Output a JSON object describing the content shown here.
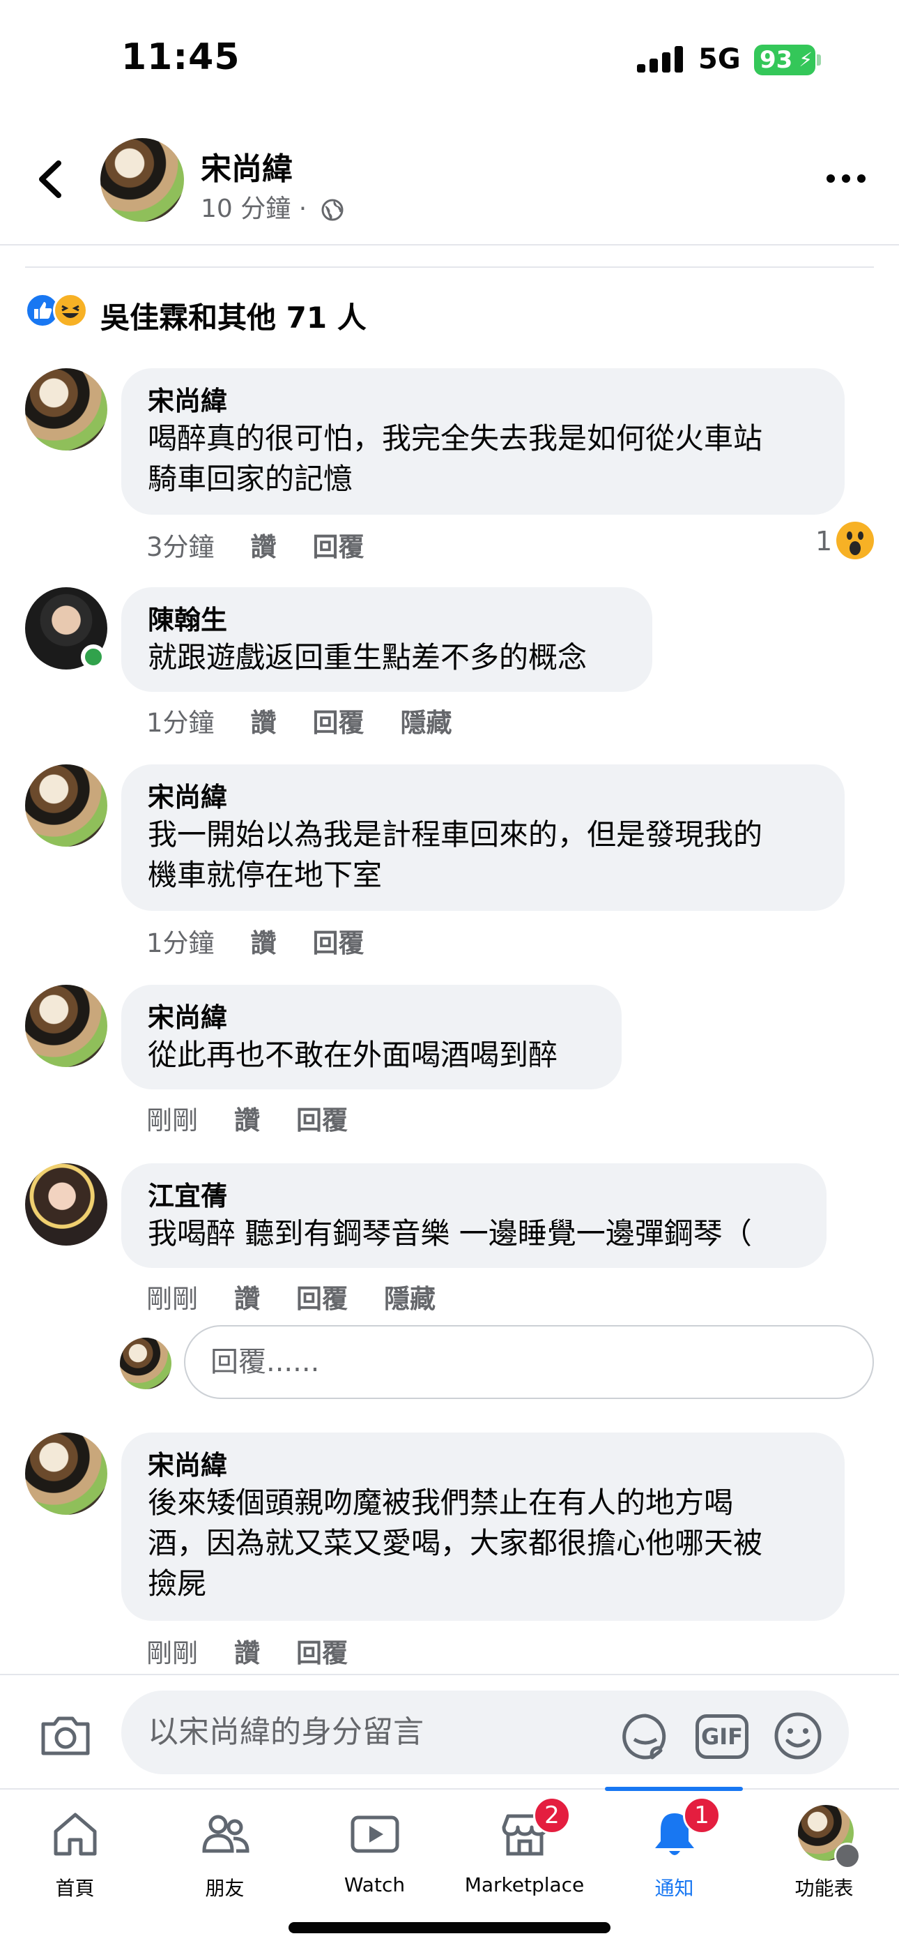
{
  "status_bar": {
    "time": "11:45",
    "network": "5G",
    "battery": "93"
  },
  "header": {
    "author": "宋尚緯",
    "meta": "10 分鐘 ·"
  },
  "reactions": {
    "summary": "吳佳霖和其他 71 人"
  },
  "comments": [
    {
      "name": "宋尚緯",
      "text": "喝醉真的很可怕，我完全失去我是如何從火車站\n騎車回家的記憶",
      "time": "3分鐘",
      "like": "讚",
      "reply": "回覆",
      "reaction_count": "1"
    },
    {
      "name": "陳翰生",
      "text": "就跟遊戲返回重生點差不多的概念",
      "time": "1分鐘",
      "like": "讚",
      "reply": "回覆",
      "hide": "隱藏"
    },
    {
      "name": "宋尚緯",
      "text": "我一開始以為我是計程車回來的，但是發現我的\n機車就停在地下室",
      "time": "1分鐘",
      "like": "讚",
      "reply": "回覆"
    },
    {
      "name": "宋尚緯",
      "text": "從此再也不敢在外面喝酒喝到醉",
      "time": "剛剛",
      "like": "讚",
      "reply": "回覆"
    },
    {
      "name": "江宜蒨",
      "text": "我喝醉 聽到有鋼琴音樂 一邊睡覺一邊彈鋼琴（",
      "time": "剛剛",
      "like": "讚",
      "reply": "回覆",
      "hide": "隱藏"
    },
    {
      "name": "宋尚緯",
      "text": "後來矮個頭親吻魔被我們禁止在有人的地方喝\n酒，因為就又菜又愛喝，大家都很擔心他哪天被\n撿屍",
      "time": "剛剛",
      "like": "讚",
      "reply": "回覆"
    }
  ],
  "reply_box": {
    "placeholder": "回覆......"
  },
  "composer": {
    "placeholder": "以宋尚緯的身分留言",
    "gif_label": "GIF"
  },
  "tabs": [
    {
      "label": "首頁",
      "icon": "home-icon"
    },
    {
      "label": "朋友",
      "icon": "friends-icon"
    },
    {
      "label": "Watch",
      "icon": "watch-icon"
    },
    {
      "label": "Marketplace",
      "icon": "marketplace-icon",
      "badge": "2"
    },
    {
      "label": "通知",
      "icon": "bell-icon",
      "badge": "1",
      "active": true
    },
    {
      "label": "功能表",
      "icon": "menu-icon"
    }
  ],
  "colors": {
    "accent": "#1877f2",
    "badge": "#e41e3f",
    "bubble": "#f0f2f5",
    "online": "#31a24c",
    "battery": "#34c759"
  }
}
